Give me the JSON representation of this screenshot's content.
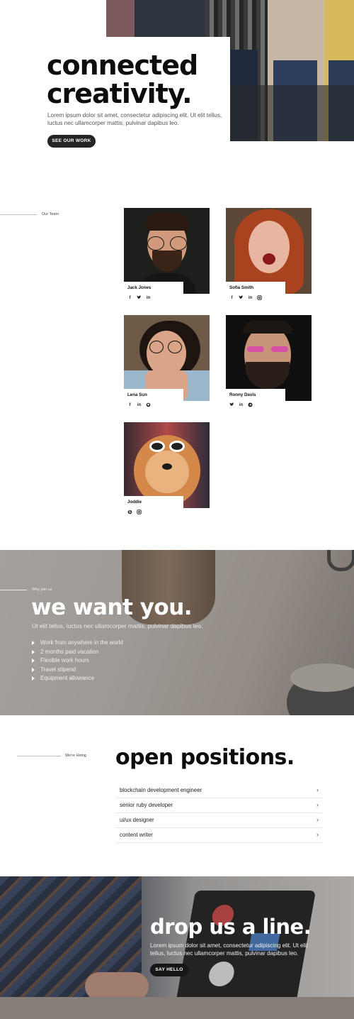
{
  "hero": {
    "title_line1": "connected",
    "title_line2": "creativity.",
    "text": "Lorem ipsum dolor sit amet, consectetur adipiscing elit. Ut elit tellus, luctus nec ullamcorper mattis, pulvinar dapibus leo.",
    "button_label": "SEE OUR WORK"
  },
  "team": {
    "label": "Our Team",
    "members": [
      {
        "name": "Jack Jones",
        "socials": [
          "facebook-icon",
          "twitter-icon",
          "linkedin-icon"
        ]
      },
      {
        "name": "Sofia Smith",
        "socials": [
          "facebook-icon",
          "twitter-icon",
          "linkedin-icon",
          "instagram-icon"
        ]
      },
      {
        "name": "Lena Sun",
        "socials": [
          "facebook-icon",
          "linkedin-icon",
          "github-icon"
        ]
      },
      {
        "name": "Ronny Davis",
        "socials": [
          "twitter-icon",
          "linkedin-icon",
          "telegram-icon"
        ]
      },
      {
        "name": "Joddie",
        "socials": [
          "skype-icon",
          "instagram-icon"
        ]
      }
    ]
  },
  "why": {
    "label": "Why join us",
    "title": "we want you.",
    "text": "Ut elit tellus, luctus nec ullamcorper mattis, pulvinar dapibus leo.",
    "perks": [
      "Work from anywhere in the world",
      "2 months paid vacation",
      "Flexible work hours",
      "Travel stipend",
      "Equipment allowance"
    ]
  },
  "positions": {
    "label": "We're Hiring",
    "title": "open positions.",
    "jobs": [
      "blockchain development engineer",
      "senior ruby developer",
      "ui/ux designer",
      "content writer"
    ],
    "chevron": "›"
  },
  "contact": {
    "title": "drop us a line.",
    "text": "Lorem ipsum dolor sit amet, consectetur adipiscing elit. Ut elit tellus, luctus nec ullamcorper mattis, pulvinar dapibus leo.",
    "button_label": "SAY HELLO"
  },
  "colors": {
    "button_dark": "#242424",
    "text_dark": "#0d0d0d",
    "divider": "#e5e5e5"
  }
}
